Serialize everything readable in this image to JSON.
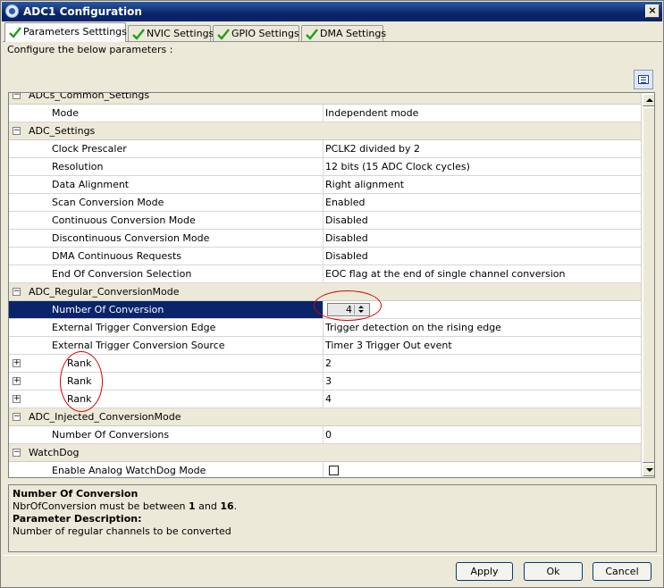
{
  "window": {
    "title": "ADC1 Configuration",
    "close_glyph": "×",
    "icon": "adc-config-icon"
  },
  "tabs": [
    {
      "label": "Parameters Setttings",
      "active": true,
      "icon": "check-icon"
    },
    {
      "label": "NVIC Settings",
      "active": false,
      "icon": "check-icon"
    },
    {
      "label": "GPIO Settings",
      "active": false,
      "icon": "check-icon"
    },
    {
      "label": "DMA Settings",
      "active": false,
      "icon": "check-icon"
    }
  ],
  "configure_label": "Configure the below parameters :",
  "grid": {
    "partial_top_label": "ADCs_Common_Settings",
    "rows": [
      {
        "kind": "param",
        "name": "Mode",
        "value": "Independent mode"
      },
      {
        "kind": "cat",
        "name": "ADC_Settings",
        "toggle": "−"
      },
      {
        "kind": "param",
        "name": "Clock Prescaler",
        "value": "PCLK2 divided by 2"
      },
      {
        "kind": "param",
        "name": "Resolution",
        "value": "12 bits (15 ADC Clock cycles)"
      },
      {
        "kind": "param",
        "name": "Data Alignment",
        "value": "Right alignment"
      },
      {
        "kind": "param",
        "name": "Scan Conversion Mode",
        "value": "Enabled"
      },
      {
        "kind": "param",
        "name": "Continuous Conversion Mode",
        "value": "Disabled"
      },
      {
        "kind": "param",
        "name": "Discontinuous Conversion Mode",
        "value": "Disabled"
      },
      {
        "kind": "param",
        "name": "DMA Continuous Requests",
        "value": "Disabled"
      },
      {
        "kind": "param",
        "name": "End Of Conversion Selection",
        "value": "EOC flag at the end of single channel conversion"
      },
      {
        "kind": "cat",
        "name": "ADC_Regular_ConversionMode",
        "toggle": "−"
      },
      {
        "kind": "spinner",
        "name": "Number Of Conversion",
        "value": "4",
        "selected": true
      },
      {
        "kind": "param",
        "name": "External Trigger Conversion Edge",
        "value": "Trigger detection on the rising edge"
      },
      {
        "kind": "param",
        "name": "External Trigger Conversion Source",
        "value": "Timer 3 Trigger Out event"
      },
      {
        "kind": "rank",
        "name": "Rank",
        "value": "2",
        "toggle": "+"
      },
      {
        "kind": "rank",
        "name": "Rank",
        "value": "3",
        "toggle": "+"
      },
      {
        "kind": "rank",
        "name": "Rank",
        "value": "4",
        "toggle": "+"
      },
      {
        "kind": "cat",
        "name": "ADC_Injected_ConversionMode",
        "toggle": "−"
      },
      {
        "kind": "param",
        "name": "Number Of Conversions",
        "value": "0"
      },
      {
        "kind": "cat",
        "name": "WatchDog",
        "toggle": "−"
      },
      {
        "kind": "checkbox",
        "name": "Enable Analog WatchDog Mode",
        "checked": false
      }
    ]
  },
  "description": {
    "param_title": "Number Of Conversion",
    "range_prefix": "NbrOfConversion must be between ",
    "range_min": "1",
    "range_mid": " and ",
    "range_max": "16",
    "range_suffix": ".",
    "desc_title": "Parameter Description:",
    "desc_text": "Number of regular channels to be converted"
  },
  "buttons": {
    "apply": "Apply",
    "ok": "Ok",
    "cancel": "Cancel"
  },
  "colors": {
    "selection": "#0a246a",
    "annotation": "#d40000",
    "check": "#1e9e1e"
  }
}
